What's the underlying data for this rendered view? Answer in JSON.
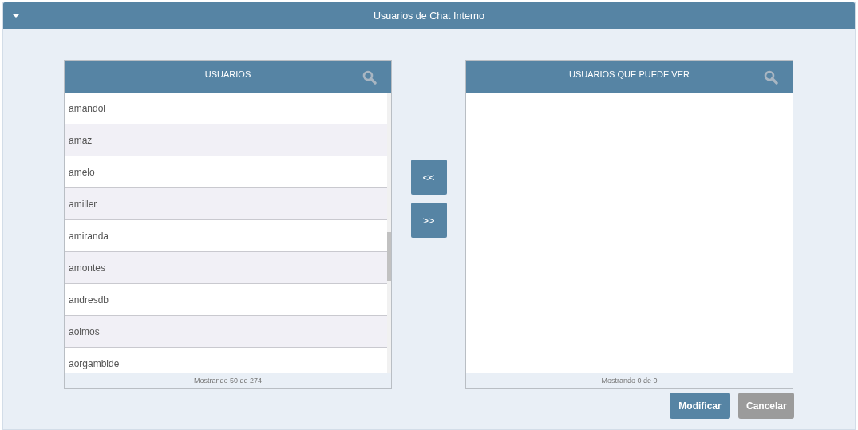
{
  "panel": {
    "title": "Usuarios de Chat Interno",
    "expanded": true
  },
  "lists": [
    {
      "title": "USUARIOS",
      "items": [
        "amandol",
        "amaz",
        "amelo",
        "amiller",
        "amiranda",
        "amontes",
        "andresdb",
        "aolmos",
        "aorgambide"
      ],
      "footer": "Mostrando 50 de 274"
    },
    {
      "title": "USUARIOS QUE PUEDE VER",
      "footer": "Mostrando 0 de 0"
    }
  ],
  "move_buttons": [
    "<<",
    ">>"
  ],
  "buttons": [
    {
      "label": "Modificar",
      "kind": "primary"
    },
    {
      "label": "Cancelar",
      "kind": "secondary"
    }
  ]
}
